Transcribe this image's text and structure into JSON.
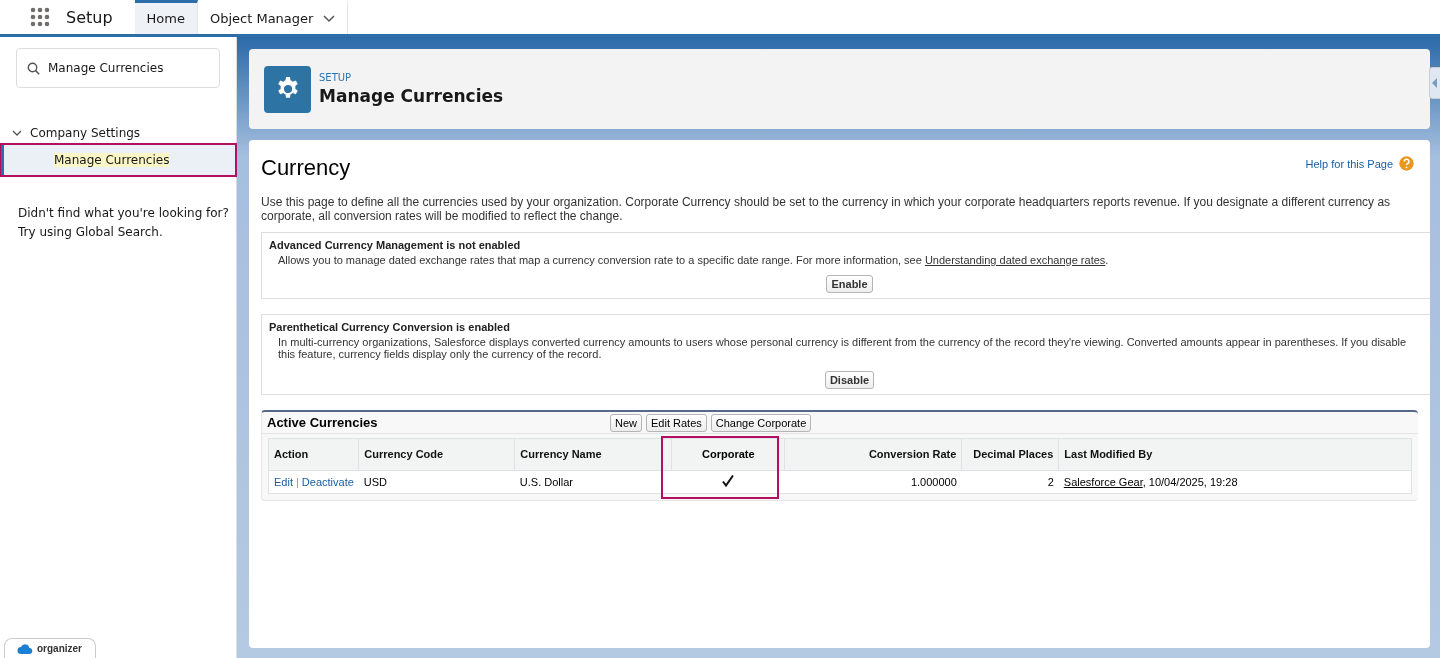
{
  "top_nav": {
    "app_name": "Setup",
    "tabs": [
      {
        "label": "Home",
        "selected": true,
        "has_menu": false
      },
      {
        "label": "Object Manager",
        "selected": false,
        "has_menu": true
      }
    ]
  },
  "sidebar": {
    "search": {
      "value": "Manage Currencies"
    },
    "tree": [
      {
        "label": "Company Settings",
        "expanded": true,
        "children": [
          {
            "label": "Manage Currencies",
            "selected": true,
            "highlighted": true
          }
        ]
      }
    ],
    "hint_lines": [
      "Didn't find what you're looking for?",
      "Try using Global Search."
    ],
    "organizer_badge": "organizer"
  },
  "header": {
    "eyebrow": "SETUP",
    "title": "Manage Currencies"
  },
  "content": {
    "title": "Currency",
    "help_link": "Help for this Page",
    "intro": "Use this page to define all the currencies used by your organization. Corporate Currency should be set to the currency in which your corporate headquarters reports revenue. If you designate a different currency as corporate, all conversion rates will be modified to reflect the change.",
    "sections": [
      {
        "title": "Advanced Currency Management is not enabled",
        "text": "Allows you to manage dated exchange rates that map a currency conversion rate to a specific date range. For more information, see ",
        "link": "Understanding dated exchange rates",
        "text_after": ".",
        "button": "Enable"
      },
      {
        "title": "Parenthetical Currency Conversion is enabled",
        "text": "In multi-currency organizations, Salesforce displays converted currency amounts to users whose personal currency is different from the currency of the record they're viewing. Converted amounts appear in parentheses. If you disable this feature, currency fields display only the currency of the record.",
        "button": "Disable"
      }
    ],
    "active_currencies": {
      "title": "Active Currencies",
      "buttons": [
        "New",
        "Edit Rates",
        "Change Corporate"
      ],
      "columns": [
        {
          "label": "Action",
          "highlighted": false
        },
        {
          "label": "Currency Code",
          "highlighted": false
        },
        {
          "label": "Currency Name",
          "highlighted": false
        },
        {
          "label": "Corporate",
          "highlighted": true
        },
        {
          "label": "Conversion Rate",
          "highlighted": false
        },
        {
          "label": "Decimal Places",
          "highlighted": false
        },
        {
          "label": "Last Modified By",
          "highlighted": false
        }
      ],
      "rows": [
        {
          "actions": [
            "Edit",
            "Deactivate"
          ],
          "separator": "|",
          "code": "USD",
          "name": "U.S. Dollar",
          "corporate": true,
          "rate": "1.000000",
          "decimal_places": "2",
          "modified_by": "Salesforce Gear",
          "modified_at": ", 10/04/2025, 19:28"
        }
      ]
    }
  }
}
